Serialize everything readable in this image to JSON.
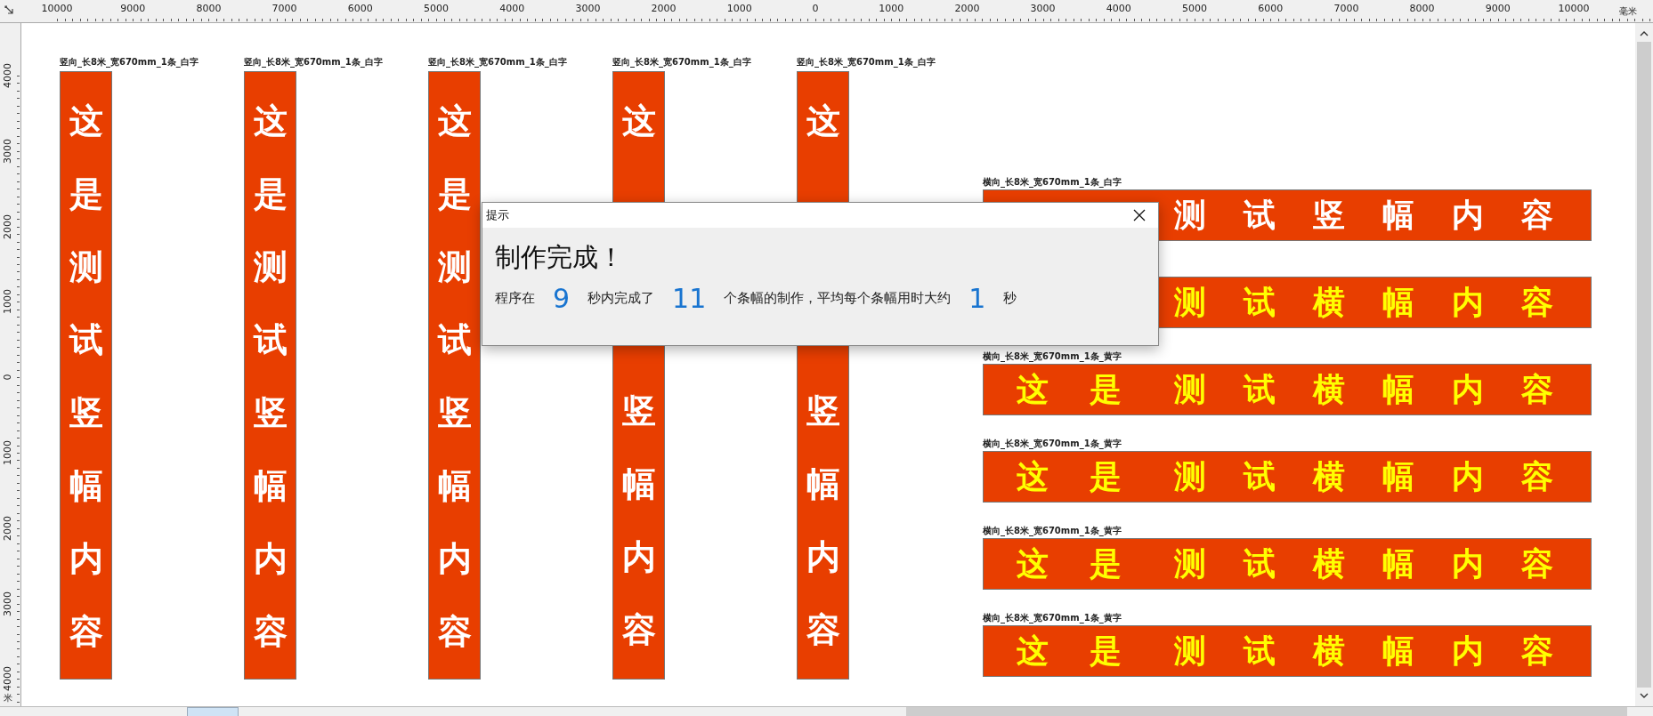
{
  "rulers": {
    "top_labels": [
      "10000",
      "9000",
      "8000",
      "7000",
      "6000",
      "5000",
      "4000",
      "3000",
      "2000",
      "1000",
      "0",
      "1000",
      "2000",
      "3000",
      "4000",
      "5000",
      "6000",
      "7000",
      "8000",
      "9000",
      "10000"
    ],
    "left_labels": [
      "4000",
      "3000",
      "2000",
      "1000",
      "0",
      "1000",
      "2000",
      "3000",
      "4000"
    ],
    "unit_top": "毫米",
    "unit_left": "米"
  },
  "vertical_banners": [
    {
      "label": "竖向_长8米_宽670mm_1条_白字",
      "color": "#ffffff",
      "upper": "这是测试",
      "lower": "竖幅内容"
    },
    {
      "label": "竖向_长8米_宽670mm_1条_白字",
      "color": "#ffffff",
      "upper": "这是测试",
      "lower": "竖幅内容"
    },
    {
      "label": "竖向_长8米_宽670mm_1条_白字",
      "color": "#ffffff",
      "upper": "这是测试",
      "lower": "竖幅内容"
    },
    {
      "label": "竖向_长8米_宽670mm_1条_白字",
      "color": "#ffffff",
      "upper": "这",
      "lower": "竖幅内容"
    },
    {
      "label": "竖向_长8米_宽670mm_1条_白字",
      "color": "#ffffff",
      "upper": "这",
      "lower": "竖幅内容"
    }
  ],
  "horizontal_banners": [
    {
      "label": "横向_长8米_宽670mm_1条_白字",
      "color": "#ffffff",
      "right": "测试竖幅内容"
    },
    {
      "color": "#ffff00",
      "right": "测试横幅内容"
    },
    {
      "label": "横向_长8米_宽670mm_1条_黄字",
      "color": "#ffff00",
      "left": "这是",
      "right": "测试横幅内容"
    },
    {
      "label": "横向_长8米_宽670mm_1条_黄字",
      "color": "#ffff00",
      "left": "这是",
      "right": "测试横幅内容"
    },
    {
      "label": "横向_长8米_宽670mm_1条_黄字",
      "color": "#ffff00",
      "left": "这是",
      "right": "测试横幅内容"
    },
    {
      "label": "横向_长8米_宽670mm_1条_黄字",
      "color": "#ffff00",
      "left": "这是",
      "right": "测试横幅内容"
    }
  ],
  "dialog": {
    "title": "提示",
    "heading": "制作完成！",
    "message": [
      {
        "kind": "text",
        "text": "程序在"
      },
      {
        "kind": "number",
        "text": "9"
      },
      {
        "kind": "text",
        "text": "秒内完成了"
      },
      {
        "kind": "number",
        "text": "11"
      },
      {
        "kind": "text",
        "text": "个条幅的制作，平均每个条幅用时大约"
      },
      {
        "kind": "number",
        "text": "1"
      },
      {
        "kind": "text",
        "text": "秒"
      }
    ]
  }
}
